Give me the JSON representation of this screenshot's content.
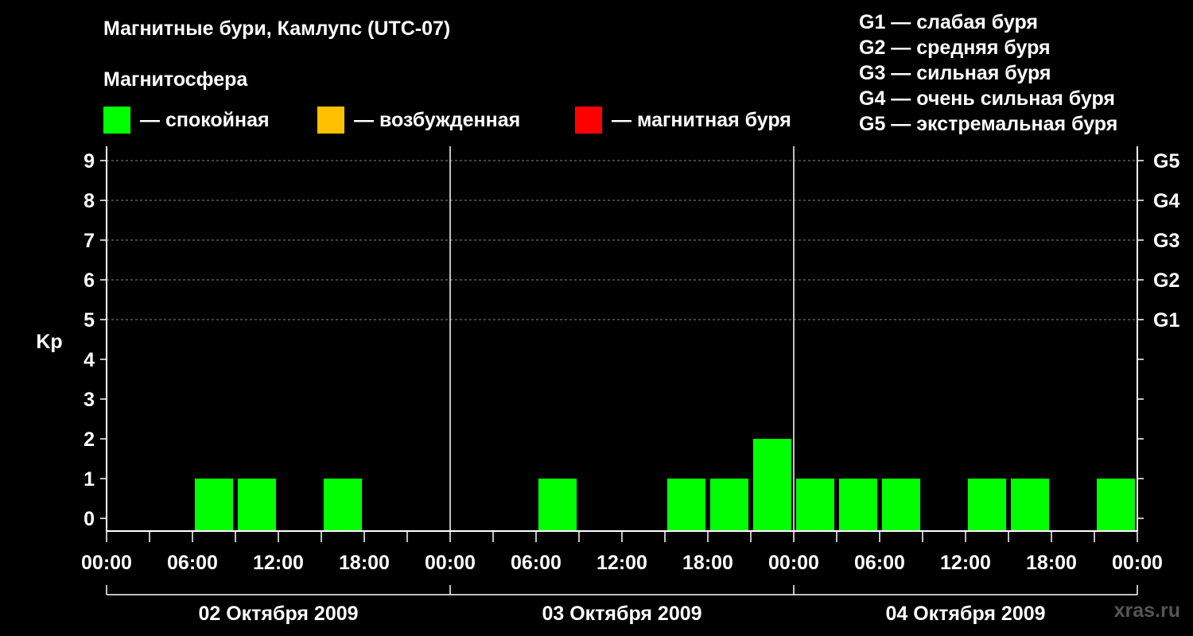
{
  "title": "Магнитные бури, Камлупс (UTC-07)",
  "legend_heading": "Магнитосфера",
  "legend": [
    {
      "label": "— спокойная",
      "color": "#00FF00"
    },
    {
      "label": "— возбужденная",
      "color": "#FFC000"
    },
    {
      "label": "— магнитная буря",
      "color": "#FF0000"
    }
  ],
  "g_levels": [
    "G1 — слабая буря",
    "G2 — средняя буря",
    "G3 — сильная буря",
    "G4 — очень сильная буря",
    "G5 — экстремальная буря"
  ],
  "brand": "xras.ru",
  "chart_data": {
    "type": "bar",
    "ylabel": "Kp",
    "ylim": [
      0,
      9
    ],
    "y_ticks": [
      "0",
      "1",
      "2",
      "3",
      "4",
      "5",
      "6",
      "7",
      "8",
      "9"
    ],
    "right_axis": [
      {
        "kp": 5,
        "label": "G1"
      },
      {
        "kp": 6,
        "label": "G2"
      },
      {
        "kp": 7,
        "label": "G3"
      },
      {
        "kp": 8,
        "label": "G4"
      },
      {
        "kp": 9,
        "label": "G5"
      }
    ],
    "x_tick_labels": [
      "00:00",
      "06:00",
      "12:00",
      "18:00",
      "00:00",
      "06:00",
      "12:00",
      "18:00",
      "00:00",
      "06:00",
      "12:00",
      "18:00",
      "00:00"
    ],
    "days": [
      "02 Октября 2009",
      "03 Октября 2009",
      "04 Октября 2009"
    ],
    "interval_hours": 3,
    "grid": true,
    "values": [
      0,
      0,
      1,
      1,
      0,
      1,
      0,
      0,
      0,
      0,
      1,
      0,
      0,
      1,
      1,
      2,
      1,
      1,
      1,
      0,
      1,
      1,
      0,
      1
    ],
    "bar_colors": [
      "#00FF00",
      "#00FF00",
      "#00FF00",
      "#00FF00",
      "#00FF00",
      "#00FF00",
      "#00FF00",
      "#00FF00",
      "#00FF00",
      "#00FF00",
      "#00FF00",
      "#00FF00",
      "#00FF00",
      "#00FF00",
      "#00FF00",
      "#00FF00",
      "#00FF00",
      "#00FF00",
      "#00FF00",
      "#00FF00",
      "#00FF00",
      "#00FF00",
      "#00FF00",
      "#00FF00"
    ]
  }
}
